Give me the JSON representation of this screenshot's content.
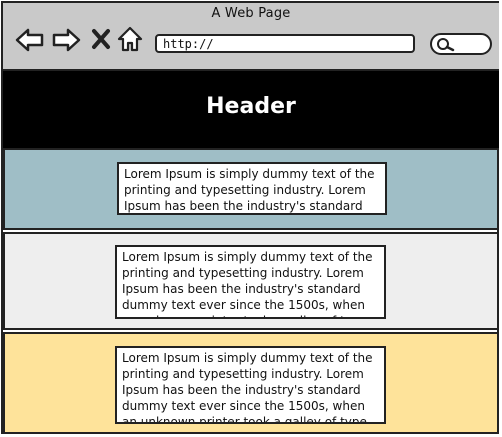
{
  "window": {
    "title": "A Web Page"
  },
  "toolbar": {
    "icons": [
      "back-arrow-icon",
      "forward-arrow-icon",
      "close-icon",
      "home-icon",
      "search-icon"
    ],
    "url_value": "http://"
  },
  "header": {
    "title": "Header"
  },
  "sections": [
    {
      "background": "#9fbec6",
      "text": "Lorem Ipsum is simply dummy text of the printing and typesetting industry. Lorem Ipsum has been the industry's standard"
    },
    {
      "background": "#eeeeee",
      "text": "Lorem Ipsum is simply dummy text of the printing and typesetting industry. Lorem Ipsum has been the industry's standard dummy text ever since the 1500s, when an unknown printer took a galley of type and"
    },
    {
      "background": "#fee39a",
      "text": "Lorem Ipsum is simply dummy text of the printing and typesetting industry. Lorem Ipsum has been the industry's standard dummy text ever since the 1500s, when an unknown printer took a galley of type and"
    }
  ],
  "colors": {
    "titlebar": "#c9c9c9",
    "header_band": "#000000",
    "outline": "#222222"
  }
}
